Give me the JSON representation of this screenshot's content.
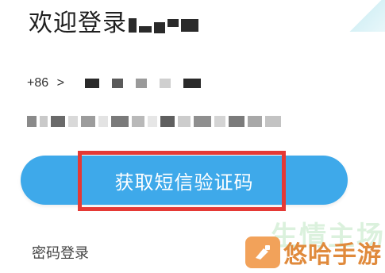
{
  "header": {
    "title": "欢迎登录",
    "username_masked": "█▀▄▀"
  },
  "phone": {
    "country_code": "+86",
    "country_chevron": ">",
    "number_masked": "█ █ █ █"
  },
  "code_field": {
    "masked_value": "▒▒▒▒▒▒▒▒"
  },
  "actions": {
    "get_sms_code_label": "获取短信验证码",
    "password_login_label": "密码登录"
  },
  "watermark": {
    "brand_text": "悠哈手游",
    "ghost_text": "生情主场"
  },
  "colors": {
    "button_blue": "#3ea9ea",
    "highlight_red": "#e53935",
    "watermark_orange": "#e08a3c"
  }
}
